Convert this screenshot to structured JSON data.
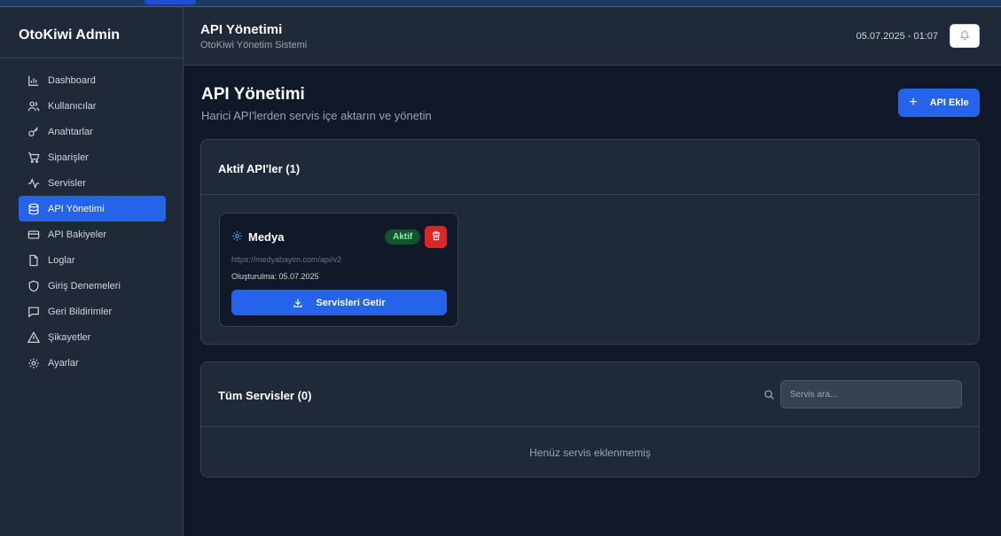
{
  "app": {
    "brand": "OtoKiwi Admin"
  },
  "sidebar": {
    "items": [
      {
        "label": "Dashboard",
        "icon": "chart-bar-icon",
        "active": false
      },
      {
        "label": "Kullanıcılar",
        "icon": "users-icon",
        "active": false
      },
      {
        "label": "Anahtarlar",
        "icon": "key-icon",
        "active": false
      },
      {
        "label": "Siparişler",
        "icon": "cart-icon",
        "active": false
      },
      {
        "label": "Servisler",
        "icon": "activity-icon",
        "active": false
      },
      {
        "label": "API Yönetimi",
        "icon": "database-icon",
        "active": true
      },
      {
        "label": "API Bakiyeler",
        "icon": "credit-card-icon",
        "active": false
      },
      {
        "label": "Loglar",
        "icon": "file-icon",
        "active": false
      },
      {
        "label": "Giriş Denemeleri",
        "icon": "shield-icon",
        "active": false
      },
      {
        "label": "Geri Bildirimler",
        "icon": "message-icon",
        "active": false
      },
      {
        "label": "Şikayetler",
        "icon": "warning-icon",
        "active": false
      },
      {
        "label": "Ayarlar",
        "icon": "gear-icon",
        "active": false
      }
    ]
  },
  "header": {
    "title": "API Yönetimi",
    "subtitle": "OtoKiwi Yönetim Sistemi",
    "datetime": "05.07.2025 - 01:07"
  },
  "page": {
    "title": "API Yönetimi",
    "subtitle": "Harici API'lerden servis içe aktarın ve yönetin",
    "add_button": "API Ekle"
  },
  "active_apis": {
    "title": "Aktif API'ler (1)",
    "cards": [
      {
        "name": "Medya",
        "status": "Aktif",
        "url": "https://medyabayim.com/api/v2",
        "created": "Oluşturulma: 05.07.2025",
        "fetch_button": "Servisleri Getir"
      }
    ]
  },
  "all_services": {
    "title": "Tüm Servisler (0)",
    "search_placeholder": "Servis ara...",
    "empty_message": "Henüz servis eklenmemiş"
  },
  "colors": {
    "accent": "#2563eb",
    "danger": "#dc2626",
    "success_bg": "#14532d",
    "success_text": "#86efac",
    "bg": "#111827",
    "panel": "#1f2937"
  }
}
